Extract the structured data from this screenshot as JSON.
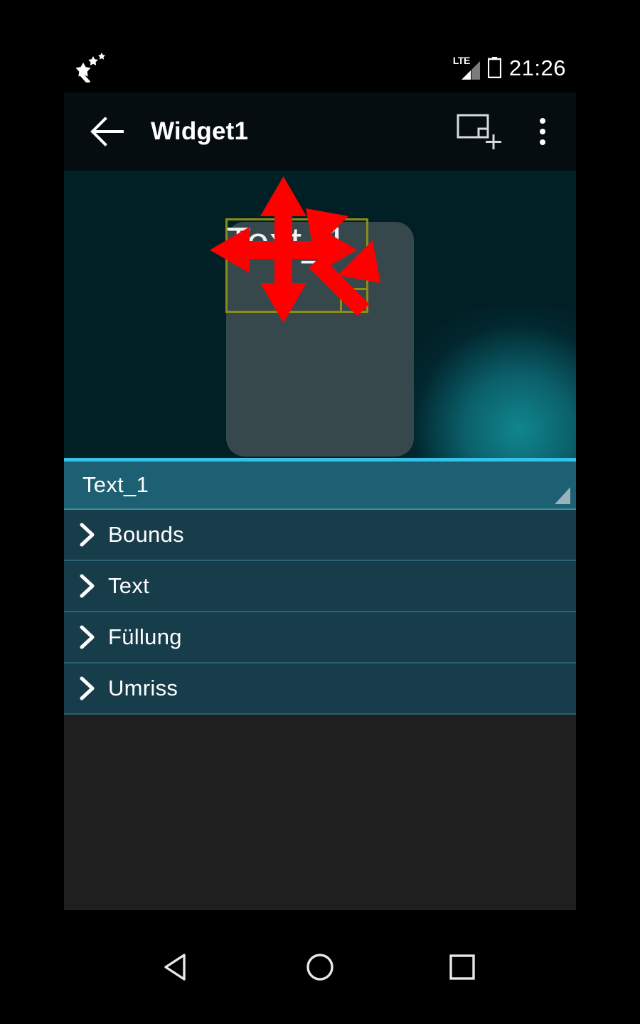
{
  "statusbar": {
    "left_icon": "magic-wand-icon",
    "network_label": "LTE",
    "signal_icon": "signal-bars-icon",
    "battery_icon": "battery-charging-icon",
    "clock": "21:26"
  },
  "appbar": {
    "back_icon": "arrow-left-icon",
    "title": "Widget1",
    "add_widget_icon": "add-widget-icon",
    "overflow_icon": "more-vert-icon"
  },
  "canvas": {
    "widget_text": "Text_1",
    "selection": {
      "handle_icon": "resize-handle",
      "move_arrow_icon": "move-cross-arrow",
      "resize_arrow_icon": "diagonal-resize-arrow"
    }
  },
  "panel": {
    "header": {
      "label": "Text_1",
      "corner_icon": "expand-corner-triangle"
    },
    "rows": [
      {
        "label": "Bounds",
        "icon": "chevron-right-icon"
      },
      {
        "label": "Text",
        "icon": "chevron-right-icon"
      },
      {
        "label": "Füllung",
        "icon": "chevron-right-icon"
      },
      {
        "label": "Umriss",
        "icon": "chevron-right-icon"
      }
    ]
  },
  "navbar": {
    "back": "nav-back-triangle-icon",
    "home": "nav-home-circle-icon",
    "recents": "nav-recents-square-icon"
  },
  "colors": {
    "accent_cyan": "#35c2e8",
    "panel_header": "#1d5f73",
    "panel_row": "#173d4a",
    "canvas_bg": "#012026",
    "widget_fill": "#37484c",
    "selection_border": "#8c8c16",
    "overlay_arrow": "#fe0000",
    "filler_bg": "#1f1f1f"
  }
}
